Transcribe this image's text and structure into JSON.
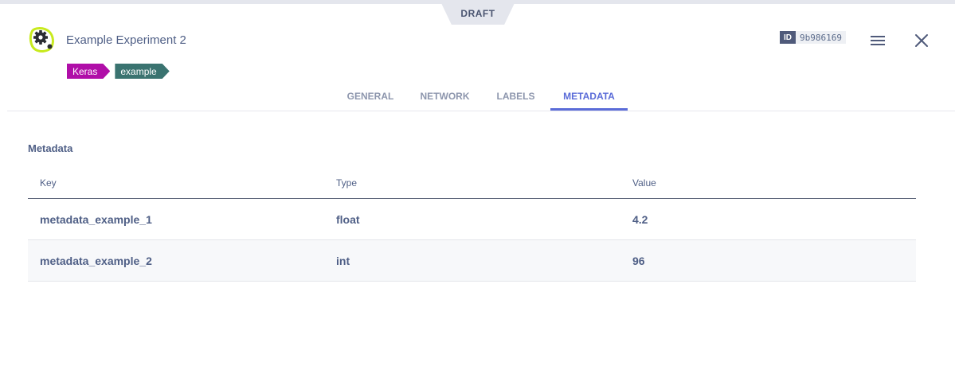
{
  "header": {
    "status_label": "DRAFT",
    "title": "Example Experiment 2",
    "tags": [
      "Keras",
      "example"
    ],
    "id_label": "ID",
    "id_value": "9b986169"
  },
  "tabs": [
    {
      "label": "GENERAL",
      "active": false
    },
    {
      "label": "NETWORK",
      "active": false
    },
    {
      "label": "LABELS",
      "active": false
    },
    {
      "label": "METADATA",
      "active": true
    }
  ],
  "metadata": {
    "section_title": "Metadata",
    "columns": [
      "Key",
      "Type",
      "Value"
    ],
    "rows": [
      {
        "key": "metadata_example_1",
        "type": "float",
        "value": "4.2"
      },
      {
        "key": "metadata_example_2",
        "type": "int",
        "value": "96"
      }
    ]
  },
  "colors": {
    "accent": "#5b6cd8",
    "tag_keras": "#b00ea8",
    "tag_example": "#3a7370",
    "logo": "#c8ea1e"
  },
  "icons": {
    "logo": "experiment-gear-icon",
    "menu": "hamburger-menu-icon",
    "close": "close-icon"
  }
}
